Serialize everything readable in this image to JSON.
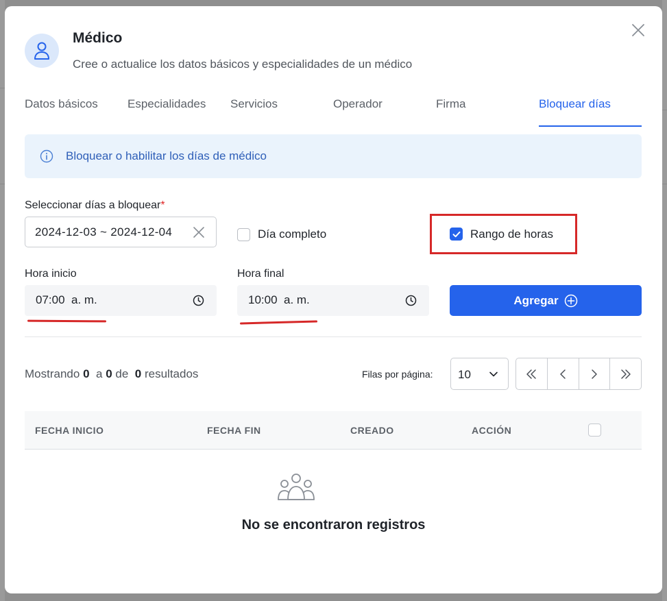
{
  "modal": {
    "title": "Médico",
    "subtitle": "Cree o actualice los datos básicos y especialidades de un médico"
  },
  "tabs": [
    {
      "label": "Datos básicos"
    },
    {
      "label": "Especialidades"
    },
    {
      "label": "Servicios"
    },
    {
      "label": "Operador"
    },
    {
      "label": "Firma"
    },
    {
      "label": "Bloquear días",
      "active": true
    }
  ],
  "info": {
    "text": "Bloquear o habilitar los días de médico"
  },
  "form": {
    "dates_label": "Seleccionar días a bloquear",
    "dates_required_mark": "*",
    "dates_value": "2024-12-03 ~ 2024-12-04",
    "full_day_label": "Día completo",
    "full_day_checked": false,
    "hour_range_label": "Rango de horas",
    "hour_range_checked": true,
    "start_label": "Hora inicio",
    "start_value": "07:00  a. m.",
    "end_label": "Hora final",
    "end_value": "10:00  a. m.",
    "add_button": "Agregar"
  },
  "pagination": {
    "showing_prefix": "Mostrando",
    "from": "0",
    "a": "a",
    "to": "0",
    "de": "de",
    "total": "0",
    "resultados": "resultados",
    "rows_label": "Filas por página:",
    "rows_value": "10"
  },
  "table": {
    "columns": [
      "FECHA INICIO",
      "FECHA FIN",
      "CREADO",
      "ACCIÓN"
    ],
    "empty_text": "No se encontraron registros"
  },
  "colors": {
    "accent": "#2563eb",
    "highlight": "#d62828",
    "info_bg": "#eaf3fc"
  }
}
